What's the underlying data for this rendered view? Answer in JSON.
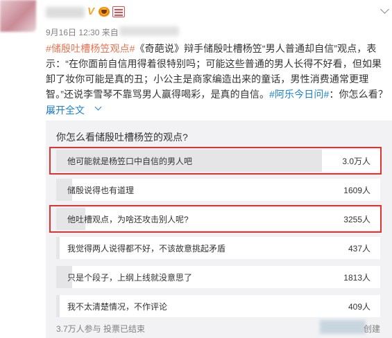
{
  "header": {
    "verified_mark": "V",
    "meta_text": "9月16日 12:30 来自"
  },
  "post": {
    "tag1": "#储殷吐槽杨笠观点#",
    "text1": "《奇葩说》辩手储殷吐槽杨笠“男人普通却自信”观点，表示：“在你面前自信用得着很特别吗；可能这些普通的男人长得不好看，但如果卸了妆你可能是真的丑；小公主是商家编造出来的童话，男性消费通常更理智。”还说李雪琴不靠骂男人赢得喝彩，是真的自信。",
    "tag2": "#阿乐今日问#",
    "text2": "：你怎么看？ …",
    "expand": "展开全文"
  },
  "poll": {
    "question": "你怎么看储殷吐槽杨笠的观点?",
    "options": [
      {
        "label": "他可能就是杨笠口中自信的男人吧",
        "count": "3.0万人",
        "share": 0.82,
        "highlighted": true
      },
      {
        "label": "储殷说得也有道理",
        "count": "1609人",
        "share": 0.05,
        "highlighted": false
      },
      {
        "label": "他吐槽观点，为啥还攻击别人呢?",
        "count": "3255人",
        "share": 0.09,
        "highlighted": true
      },
      {
        "label": "我觉得两人说得都不好，不该故意挑起矛盾",
        "count": "437人",
        "share": 0.01,
        "highlighted": false
      },
      {
        "label": "只是个段子，上纲上线就没意思了",
        "count": "1813人",
        "share": 0.05,
        "highlighted": false
      },
      {
        "label": "我不太清楚情况，不作评论",
        "count": "409人",
        "share": 0.01,
        "highlighted": false
      }
    ],
    "footer": "3.7万人参与 投票已结束",
    "create": "创建"
  },
  "colors": {
    "tag": "#eb7350",
    "link": "#1a82d1",
    "highlight_box": "#e0322e",
    "poll_bg": "#f2f2f5"
  },
  "icons": {
    "verified": "verified-v-icon",
    "vip": "vip-crown-icon",
    "level": "vip-level-icon",
    "menu": "chevron-down-icon",
    "expand": "chevron-down-icon"
  }
}
